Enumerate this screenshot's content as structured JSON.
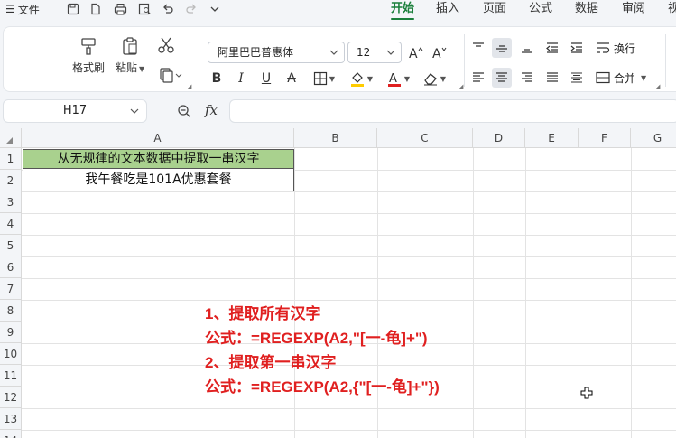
{
  "topbar": {
    "file_label": "文件",
    "tabs": [
      "开始",
      "插入",
      "页面",
      "公式",
      "数据",
      "审阅",
      "视"
    ],
    "active_tab": "开始",
    "accent": "#1a7f3b"
  },
  "ribbon": {
    "format_painter": "格式刷",
    "paste": "粘贴",
    "font_name": "阿里巴巴普惠体",
    "font_size": "12",
    "wrap_text": "换行",
    "merge": "合并",
    "bold": "B",
    "italic": "I",
    "underline": "U",
    "strike": "A",
    "font_color_glyph": "A",
    "highlight_color": "#ffcc00",
    "font_color": "#e02020"
  },
  "formula_bar": {
    "cell_ref": "H17",
    "fx": "fx",
    "value": ""
  },
  "grid": {
    "columns": [
      "A",
      "B",
      "C",
      "D",
      "E",
      "F",
      "G"
    ],
    "rows": [
      "1",
      "2",
      "3",
      "4",
      "5",
      "6",
      "7",
      "8",
      "9",
      "10",
      "11",
      "12",
      "13",
      "14"
    ],
    "a1": "从无规律的文本数据中提取一串汉字",
    "a2": "我午餐吃是101A优惠套餐",
    "header_fill": "#a9d18e"
  },
  "notes": [
    "1、提取所有汉字",
    "公式：=REGEXP(A2,\"[一-龟]+\")",
    "2、提取第一串汉字",
    "公式：=REGEXP(A2,{\"[一-龟]+\"})"
  ],
  "note_color": "#e02020"
}
